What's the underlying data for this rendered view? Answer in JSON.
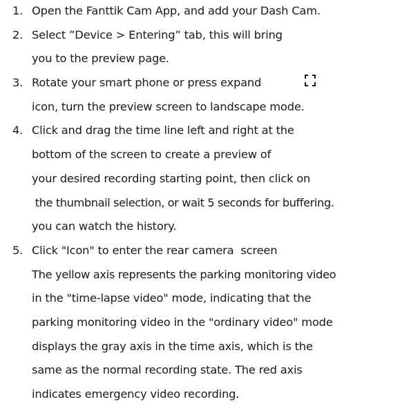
{
  "steps": [
    {
      "number": "1.",
      "lines": [
        "Open the Fanttik Cam App, and add your Dash Cam."
      ]
    },
    {
      "number": "2.",
      "lines": [
        "Select ”Device > Entering” tab, this will bring",
        "you to the preview page."
      ]
    },
    {
      "number": "3.",
      "lines": [
        "Rotate your smart phone or press expand",
        "icon, turn the preview screen to landscape mode."
      ],
      "icon": "expand-icon"
    },
    {
      "number": "4.",
      "lines": [
        "Click and drag the time line left and right at the",
        "bottom of the screen to create a preview of",
        "your desired recording starting point, then click on",
        " the thumbnail selection, or wait 5 seconds for buffering.",
        "you can watch the history."
      ]
    },
    {
      "number": "5.",
      "lines": [
        "Click \"Icon\" to enter the rear camera  screen",
        "The yellow axis represents the parking monitoring video",
        "in the \"time-lapse video\" mode, indicating that the",
        "parking monitoring video in the \"ordinary video\" mode",
        "displays the gray axis in the time axis, which is the",
        "same as the normal recording state. The red axis",
        "indicates emergency video recording."
      ]
    }
  ],
  "colors": {
    "text": "#1a1a1a",
    "background": "#ffffff"
  }
}
